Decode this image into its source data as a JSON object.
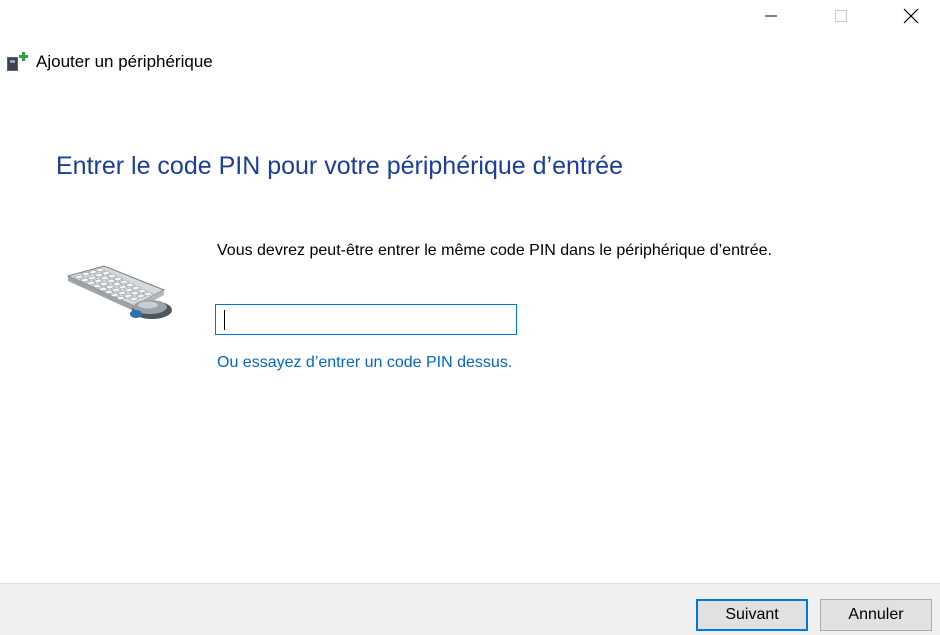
{
  "window": {
    "title": "Ajouter un périphérique",
    "app_icon": "add-device-icon",
    "controls": {
      "minimize_icon": "minimize-icon",
      "maximize_icon": "maximize-icon",
      "close_icon": "close-icon"
    }
  },
  "main": {
    "heading": "Entrer le code PIN pour votre périphérique d’entrée",
    "illustration": "keyboard-mouse-icon",
    "instruction": "Vous devrez peut-être entrer le même code PIN dans le périphérique d’entrée.",
    "pin_input": {
      "value": "",
      "placeholder": ""
    },
    "alt_link": "Ou essayez d’entrer un code PIN dessus."
  },
  "footer": {
    "next_label": "Suivant",
    "cancel_label": "Annuler"
  },
  "colors": {
    "heading": "#1a3d9e",
    "link": "#0066cc",
    "accent": "#0078d7",
    "footer_bg": "#f0f0f0"
  }
}
